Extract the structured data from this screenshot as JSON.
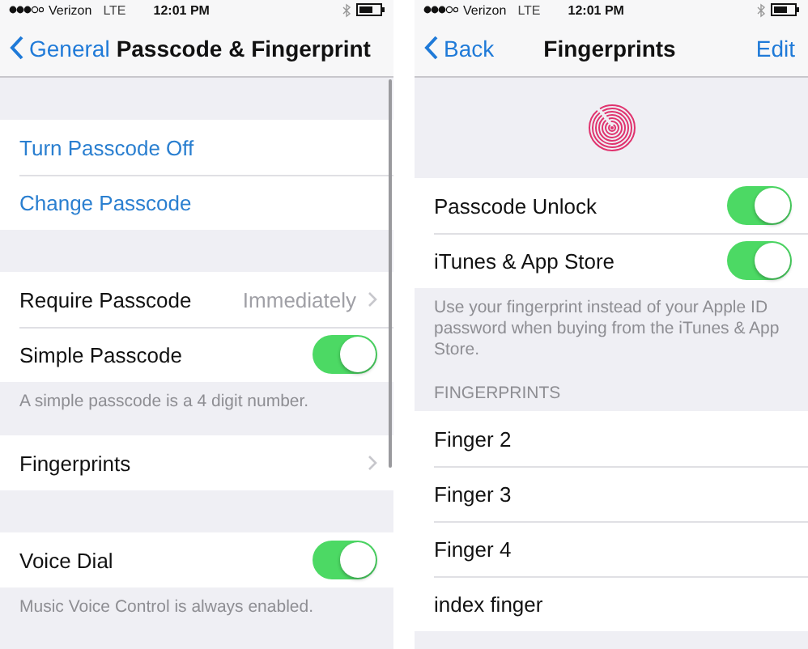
{
  "screens": [
    {
      "status_bar": {
        "carrier": "Verizon",
        "network": "LTE",
        "time": "12:01 PM"
      },
      "nav": {
        "back": "General",
        "title": "Passcode & Fingerprint"
      },
      "scrollbar": true,
      "sections": [
        {
          "rows": [
            {
              "kind": "link",
              "label": "Turn Passcode Off"
            },
            {
              "kind": "link",
              "label": "Change Passcode"
            }
          ]
        },
        {
          "rows": [
            {
              "kind": "disclosure",
              "label": "Require Passcode",
              "value": "Immediately"
            },
            {
              "kind": "toggle",
              "label": "Simple Passcode",
              "on": true
            }
          ],
          "footer": "A simple passcode is a 4 digit number."
        },
        {
          "rows": [
            {
              "kind": "disclosure",
              "label": "Fingerprints"
            }
          ]
        },
        {
          "rows": [
            {
              "kind": "toggle",
              "label": "Voice Dial",
              "on": true
            }
          ],
          "footer": "Music Voice Control is always enabled."
        }
      ]
    },
    {
      "status_bar": {
        "carrier": "Verizon",
        "network": "LTE",
        "time": "12:01 PM"
      },
      "nav": {
        "back": "Back",
        "title": "Fingerprints",
        "action": "Edit"
      },
      "banner": {
        "kind": "fingerprint"
      },
      "sections": [
        {
          "rows": [
            {
              "kind": "toggle",
              "label": "Passcode Unlock",
              "on": true
            },
            {
              "kind": "toggle",
              "label": "iTunes & App Store",
              "on": true
            }
          ],
          "footer": "Use your fingerprint instead of your Apple ID password when buying from the iTunes & App Store."
        },
        {
          "header": "FINGERPRINTS",
          "rows": [
            {
              "kind": "plain",
              "label": "Finger 2"
            },
            {
              "kind": "plain",
              "label": "Finger 3"
            },
            {
              "kind": "plain",
              "label": "Finger 4"
            },
            {
              "kind": "plain",
              "label": "index finger"
            }
          ]
        }
      ]
    }
  ]
}
